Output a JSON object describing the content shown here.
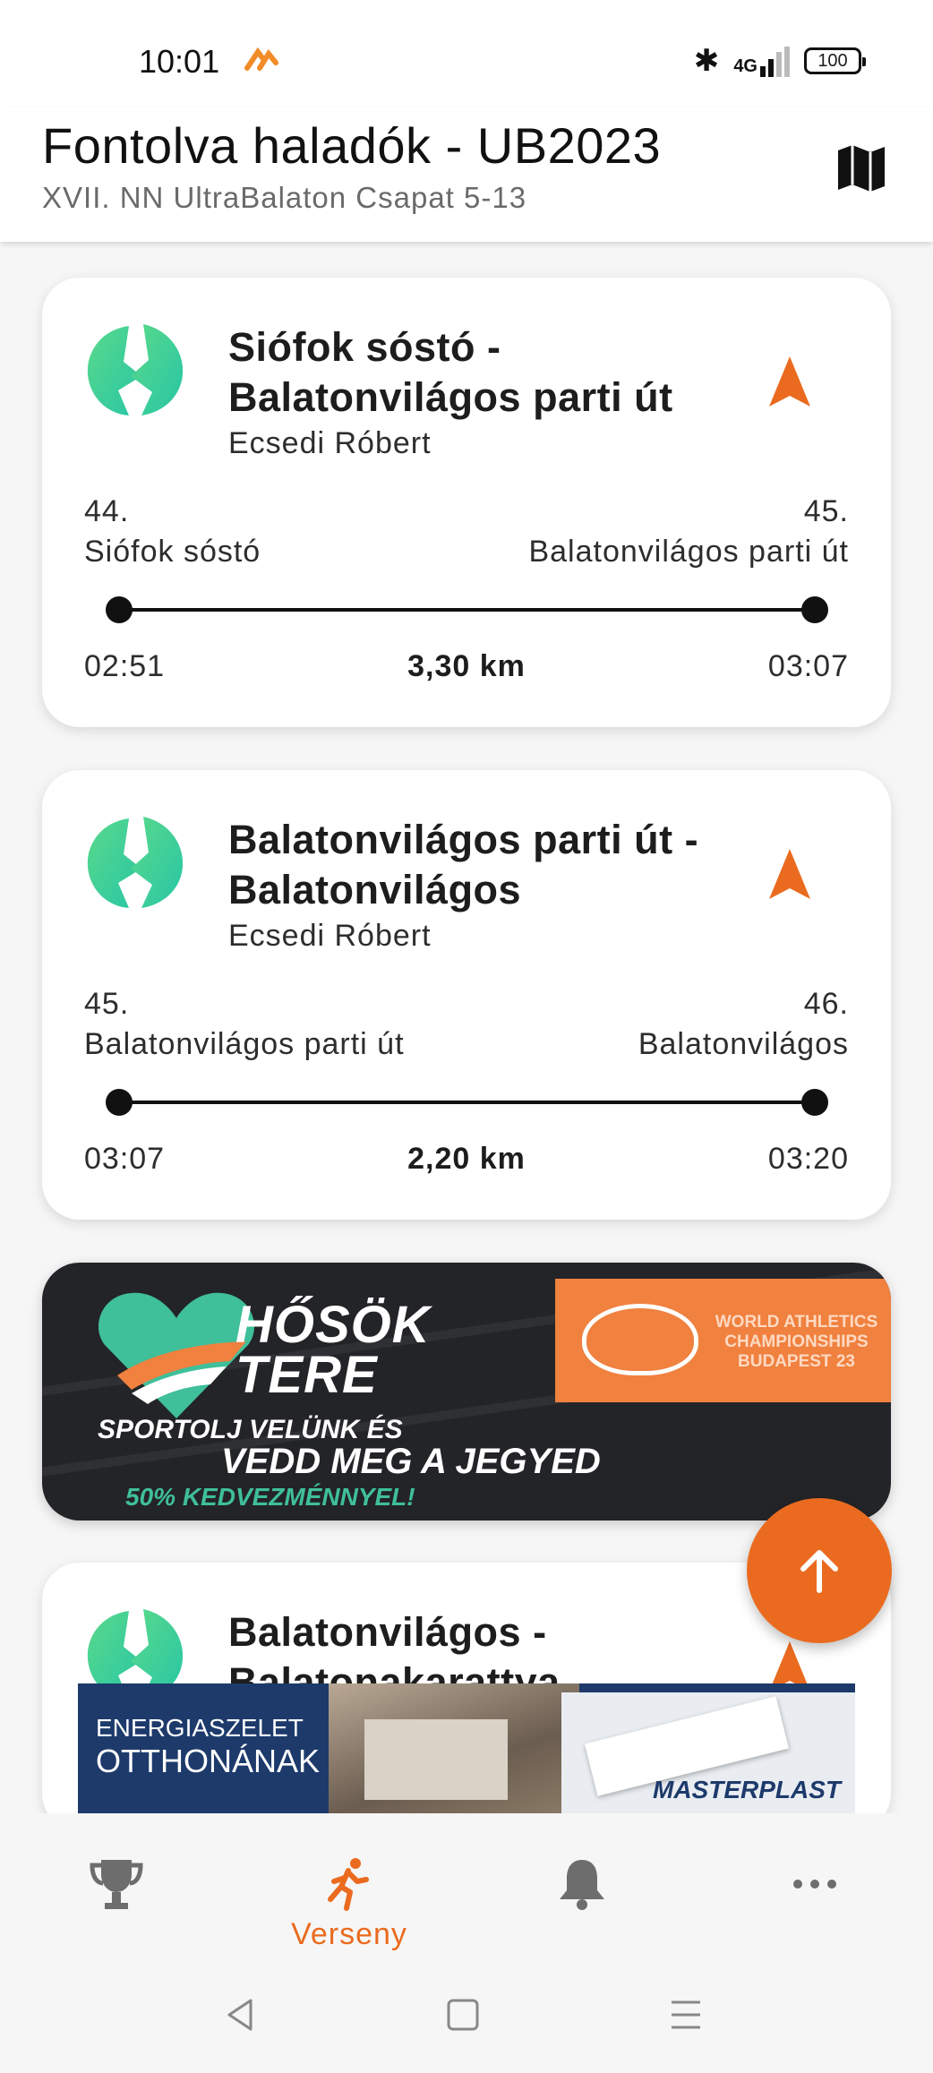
{
  "status_bar": {
    "time": "10:01",
    "network": "4G",
    "battery": "100"
  },
  "header": {
    "title": "Fontolva haladók - UB2023",
    "subtitle": "XVII. NN UltraBalaton Csapat 5-13"
  },
  "legs": [
    {
      "title": "Siófok sóstó - Balatonvilágos parti út",
      "runner": "Ecsedi Róbert",
      "from_number": "44.",
      "from_name": "Siófok sóstó",
      "to_number": "45.",
      "to_name": "Balatonvilágos parti út",
      "start_time": "02:51",
      "distance": "3,30 km",
      "end_time": "03:07"
    },
    {
      "title": "Balatonvilágos parti út - Balatonvilágos",
      "runner": "Ecsedi Róbert",
      "from_number": "45.",
      "from_name": "Balatonvilágos parti út",
      "to_number": "46.",
      "to_name": "Balatonvilágos",
      "start_time": "03:07",
      "distance": "2,20 km",
      "end_time": "03:20"
    },
    {
      "title": "Balatonvilágos - Balatonakarattya"
    }
  ],
  "promo": {
    "brand": "HŐSÖK TERE",
    "event": "WORLD ATHLETICS CHAMPIONSHIPS BUDAPEST 23",
    "line1": "SPORTOLJ VELÜNK ÉS",
    "line2": "VEDD MEG A JEGYED",
    "line3": "50% KEDVEZMÉNNYEL!"
  },
  "sponsor": {
    "line1": "ENERGIASZELET",
    "line2": "OTTHONÁNAK",
    "brand": "MASTERPLAST"
  },
  "bottom_nav": [
    {
      "icon": "trophy-icon",
      "label": ""
    },
    {
      "icon": "runner-icon",
      "label": "Verseny",
      "active": true
    },
    {
      "icon": "bell-icon",
      "label": ""
    },
    {
      "icon": "more-icon",
      "label": ""
    }
  ],
  "colors": {
    "accent": "#ea6b1f",
    "logo_green": "#3ccf8e"
  }
}
